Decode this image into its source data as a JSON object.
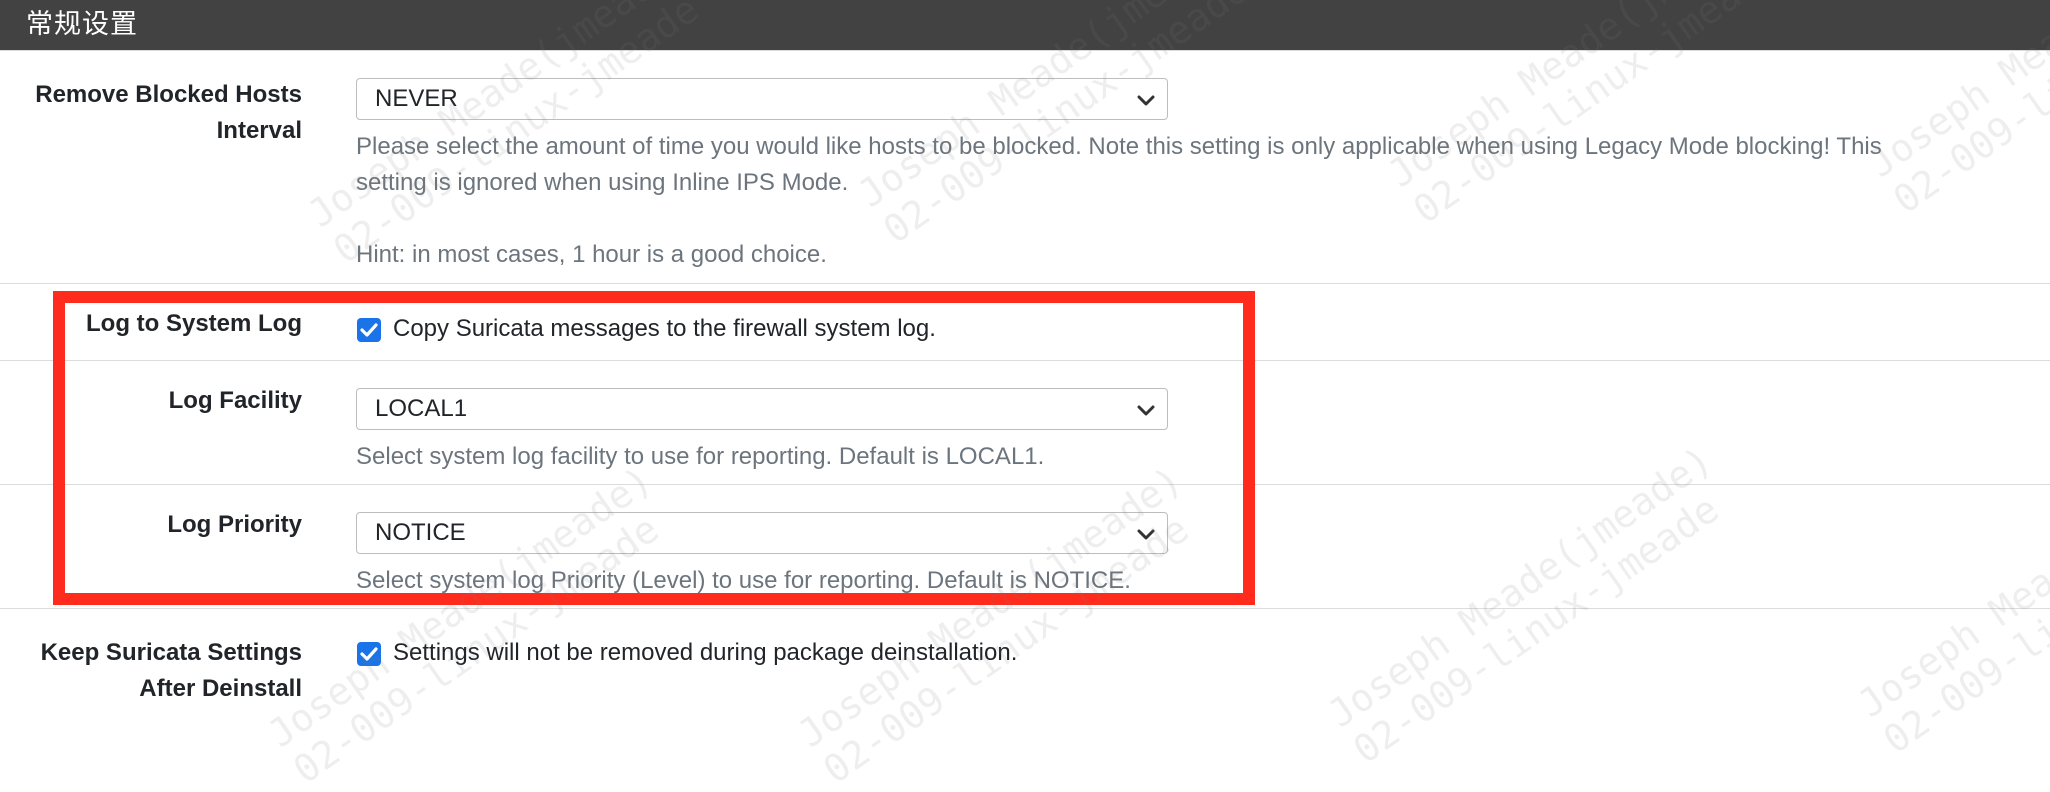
{
  "panel": {
    "title": "常规设置"
  },
  "settings": {
    "remove_blocked": {
      "label_line1": "Remove Blocked Hosts",
      "label_line2": "Interval",
      "selected": "NEVER",
      "help_line1": "Please select the amount of time you would like hosts to be blocked. Note this setting is only applicable when using Legacy Mode blocking! This",
      "help_line2": "setting is ignored when using Inline IPS Mode.",
      "hint": "Hint: in most cases, 1 hour is a good choice."
    },
    "log_to_system": {
      "label": "Log to System Log",
      "checked": true,
      "checkbox_text": "Copy Suricata messages to the firewall system log."
    },
    "log_facility": {
      "label": "Log Facility",
      "selected": "LOCAL1",
      "help": "Select system log facility to use for reporting. Default is LOCAL1."
    },
    "log_priority": {
      "label": "Log Priority",
      "selected": "NOTICE",
      "help": "Select system log Priority (Level) to use for reporting. Default is NOTICE."
    },
    "keep_settings": {
      "label_line1": "Keep Suricata Settings",
      "label_line2": "After Deinstall",
      "checked": true,
      "checkbox_text": "Settings will not be removed during package deinstallation."
    }
  },
  "watermark": {
    "line1": "Joseph Meade(jmeade)",
    "line2": "02-009-linux-jmeade"
  },
  "colors": {
    "header_bg": "#424242",
    "checkbox_accent": "#1a73e8",
    "highlight": "#ff2b1c"
  }
}
